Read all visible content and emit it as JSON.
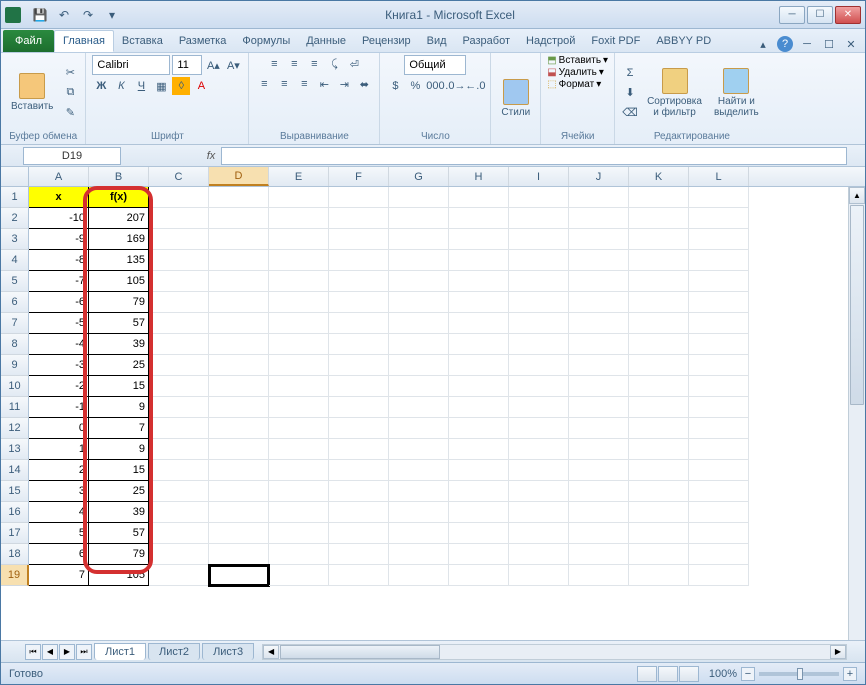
{
  "title": "Книга1  -  Microsoft Excel",
  "qat": {
    "save": "💾",
    "undo": "↶",
    "redo": "↷"
  },
  "win": {
    "min": "─",
    "max": "☐",
    "close": "✕"
  },
  "tabs": {
    "file": "Файл",
    "items": [
      "Главная",
      "Вставка",
      "Разметка",
      "Формулы",
      "Данные",
      "Рецензир",
      "Вид",
      "Разработ",
      "Надстрой",
      "Foxit PDF",
      "ABBYY PD"
    ],
    "active": 0
  },
  "ribbon": {
    "clipboard": {
      "paste": "Вставить",
      "label": "Буфер обмена"
    },
    "font": {
      "name": "Calibri",
      "size": "11",
      "label": "Шрифт"
    },
    "align": {
      "label": "Выравнивание"
    },
    "number": {
      "fmt": "Общий",
      "label": "Число"
    },
    "styles": {
      "btn": "Стили",
      "label": ""
    },
    "cells": {
      "insert": "Вставить",
      "delete": "Удалить",
      "format": "Формат",
      "label": "Ячейки"
    },
    "editing": {
      "sort": "Сортировка\nи фильтр",
      "find": "Найти и\nвыделить",
      "label": "Редактирование"
    }
  },
  "namebox": "D19",
  "fx": "fx",
  "formula": "",
  "columns": [
    "A",
    "B",
    "C",
    "D",
    "E",
    "F",
    "G",
    "H",
    "I",
    "J",
    "K",
    "L"
  ],
  "selected": {
    "col": 3,
    "row": 19
  },
  "headers": {
    "A": "x",
    "B": "f(x)"
  },
  "data": [
    {
      "r": 2,
      "x": "-10",
      "fx": "207"
    },
    {
      "r": 3,
      "x": "-9",
      "fx": "169"
    },
    {
      "r": 4,
      "x": "-8",
      "fx": "135"
    },
    {
      "r": 5,
      "x": "-7",
      "fx": "105"
    },
    {
      "r": 6,
      "x": "-6",
      "fx": "79"
    },
    {
      "r": 7,
      "x": "-5",
      "fx": "57"
    },
    {
      "r": 8,
      "x": "-4",
      "fx": "39"
    },
    {
      "r": 9,
      "x": "-3",
      "fx": "25"
    },
    {
      "r": 10,
      "x": "-2",
      "fx": "15"
    },
    {
      "r": 11,
      "x": "-1",
      "fx": "9"
    },
    {
      "r": 12,
      "x": "0",
      "fx": "7"
    },
    {
      "r": 13,
      "x": "1",
      "fx": "9"
    },
    {
      "r": 14,
      "x": "2",
      "fx": "15"
    },
    {
      "r": 15,
      "x": "3",
      "fx": "25"
    },
    {
      "r": 16,
      "x": "4",
      "fx": "39"
    },
    {
      "r": 17,
      "x": "5",
      "fx": "57"
    },
    {
      "r": 18,
      "x": "6",
      "fx": "79"
    },
    {
      "r": 19,
      "x": "7",
      "fx": "105"
    }
  ],
  "sheets": [
    "Лист1",
    "Лист2",
    "Лист3"
  ],
  "status": "Готово",
  "zoom": "100%"
}
